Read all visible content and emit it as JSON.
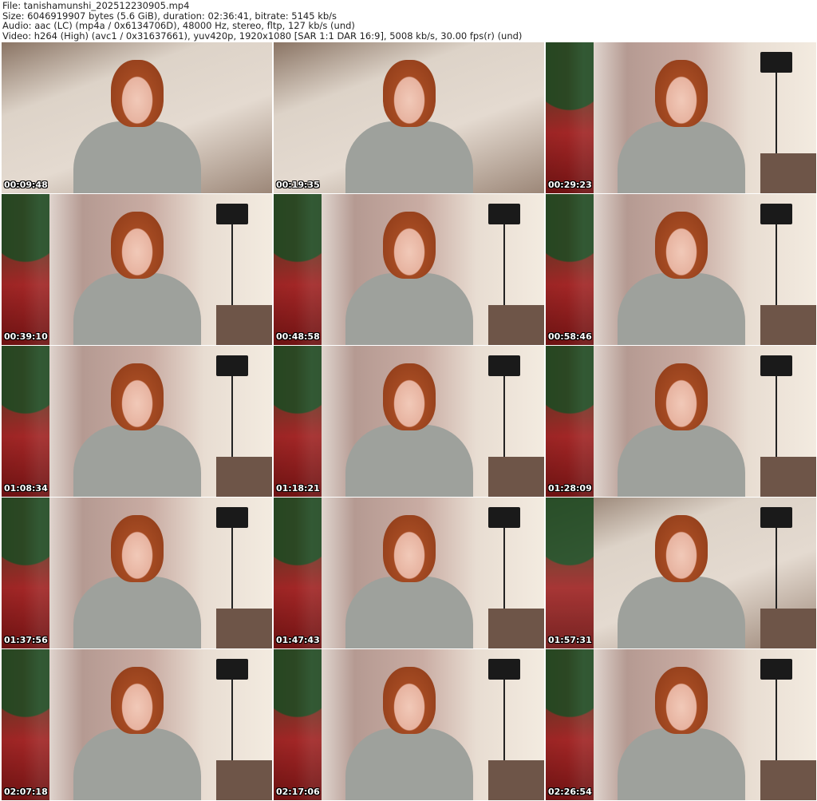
{
  "header": {
    "file": "File: tanishamunshi_202512230905.mp4",
    "size": "Size: 6046919907 bytes (5.6 GiB), duration: 02:36:41, bitrate: 5145 kb/s",
    "audio": "Audio: aac (LC) (mp4a / 0x6134706D), 48000 Hz, stereo, fltp, 127 kb/s (und)",
    "video": "Video: h264 (High) (avc1 / 0x31637661), yuv420p, 1920x1080 [SAR 1:1 DAR 16:9], 5008 kb/s, 30.00 fps(r) (und)"
  },
  "thumbnails": [
    {
      "timestamp": "00:09:48"
    },
    {
      "timestamp": "00:19:35"
    },
    {
      "timestamp": "00:29:23"
    },
    {
      "timestamp": "00:39:10"
    },
    {
      "timestamp": "00:48:58"
    },
    {
      "timestamp": "00:58:46"
    },
    {
      "timestamp": "01:08:34"
    },
    {
      "timestamp": "01:18:21"
    },
    {
      "timestamp": "01:28:09"
    },
    {
      "timestamp": "01:37:56"
    },
    {
      "timestamp": "01:47:43"
    },
    {
      "timestamp": "01:57:31"
    },
    {
      "timestamp": "02:07:18"
    },
    {
      "timestamp": "02:17:06"
    },
    {
      "timestamp": "02:26:54"
    }
  ]
}
